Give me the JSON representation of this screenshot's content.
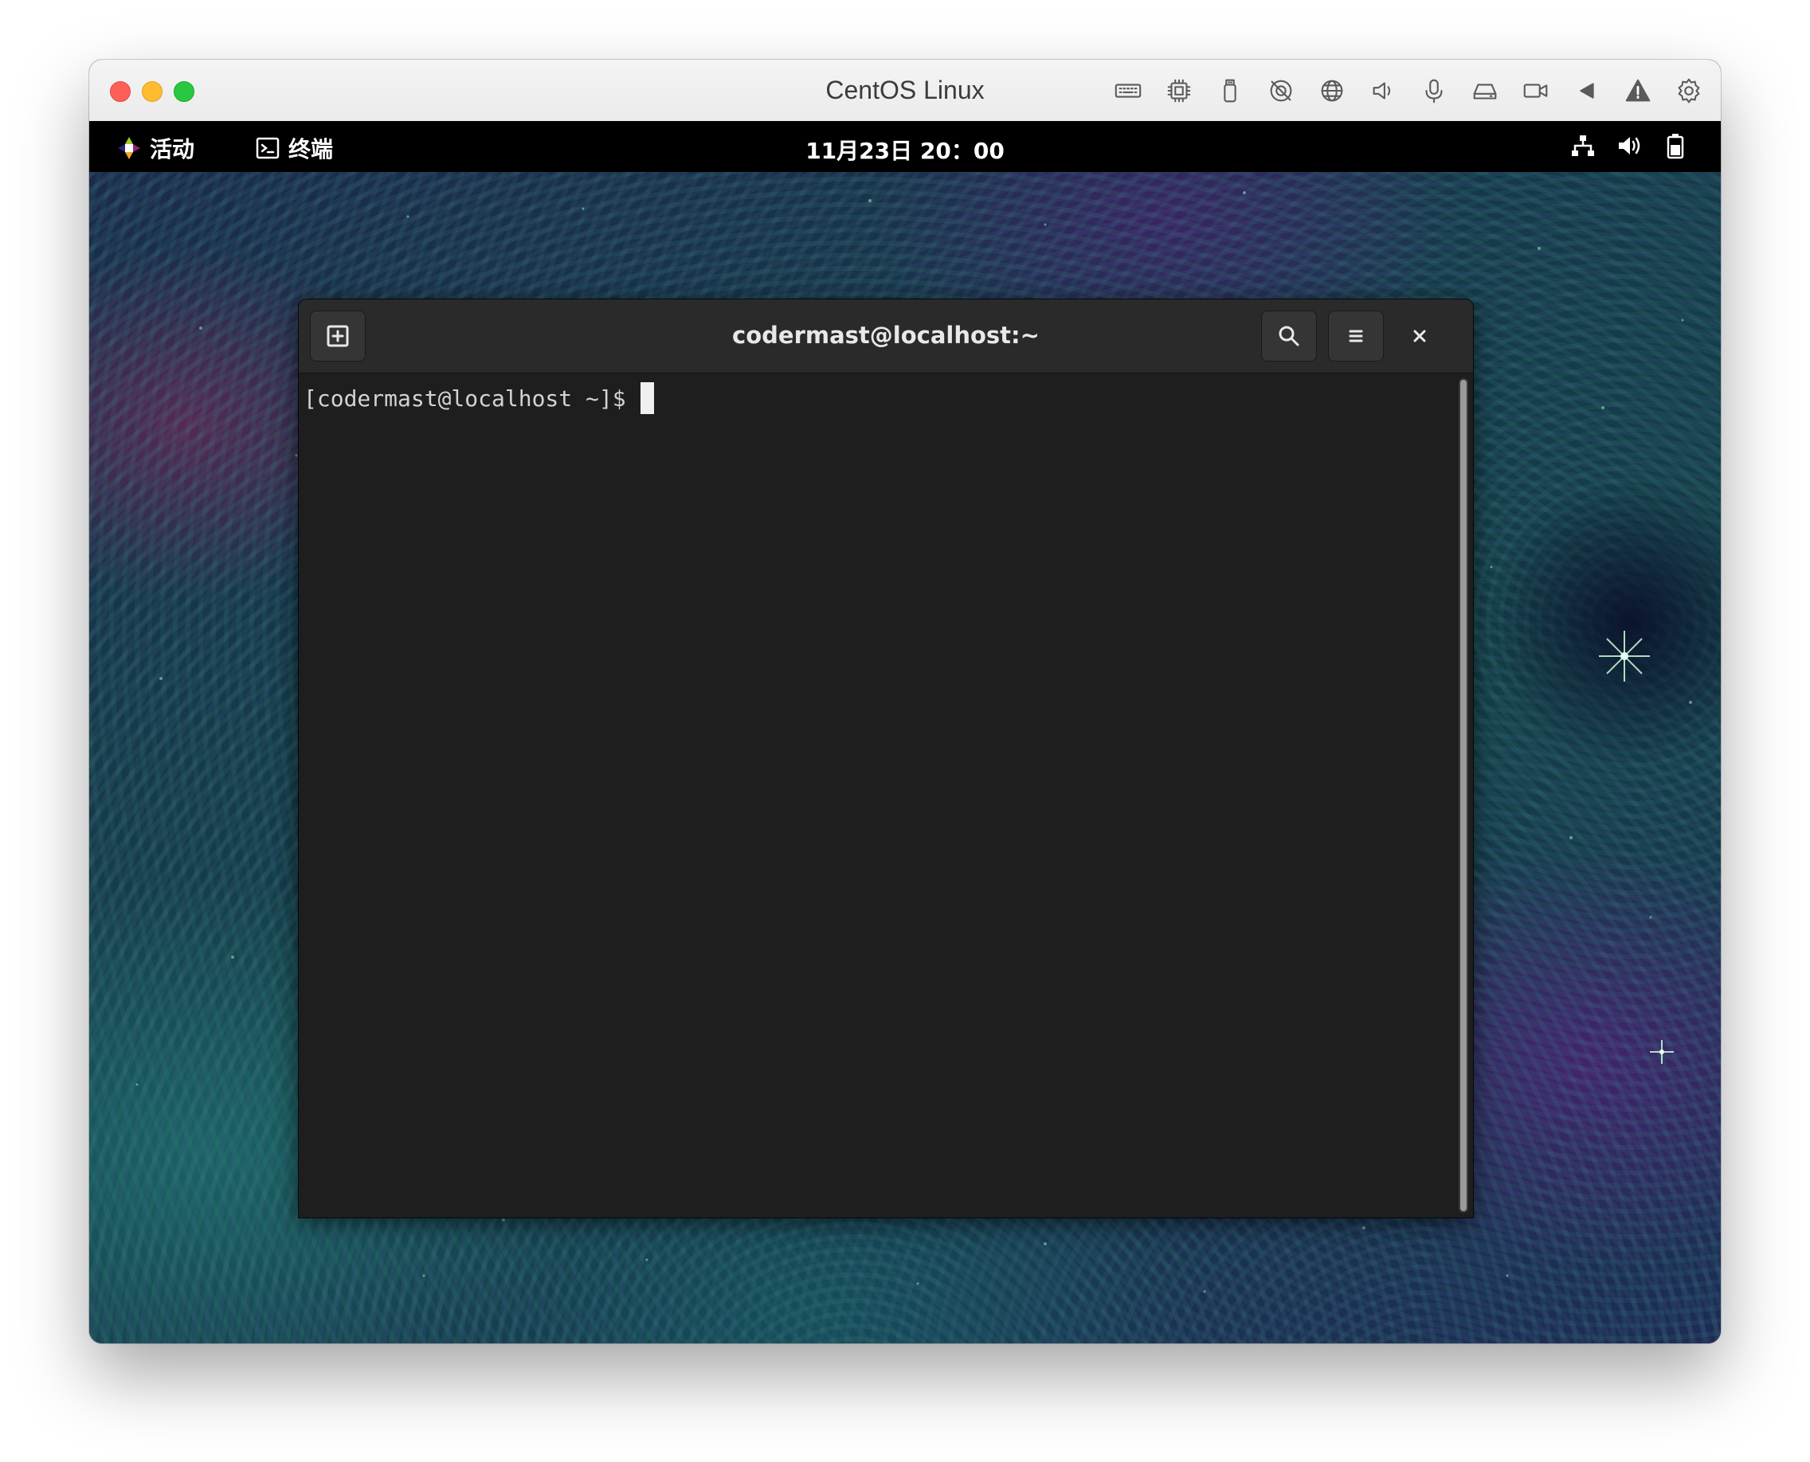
{
  "host": {
    "window_title": "CentOS Linux",
    "toolbar_icons": [
      "keyboard-icon",
      "cpu-icon",
      "usb-icon",
      "camera-off-icon",
      "globe-icon",
      "speaker-icon",
      "microphone-icon",
      "hard-drive-icon",
      "video-icon",
      "arrow-left-icon",
      "warning-icon",
      "gear-icon"
    ]
  },
  "gnome": {
    "activities_label": "活动",
    "app_menu_label": "终端",
    "clock": "11月23日 20：00",
    "tray_icons": [
      "network-icon",
      "volume-icon",
      "battery-icon"
    ]
  },
  "terminal": {
    "title": "codermast@localhost:~",
    "prompt": "[codermast@localhost ~]$"
  },
  "colors": {
    "topbar": "#000000",
    "terminal_bg": "#1e1e1e",
    "header_bg": "#2a2a2a"
  }
}
